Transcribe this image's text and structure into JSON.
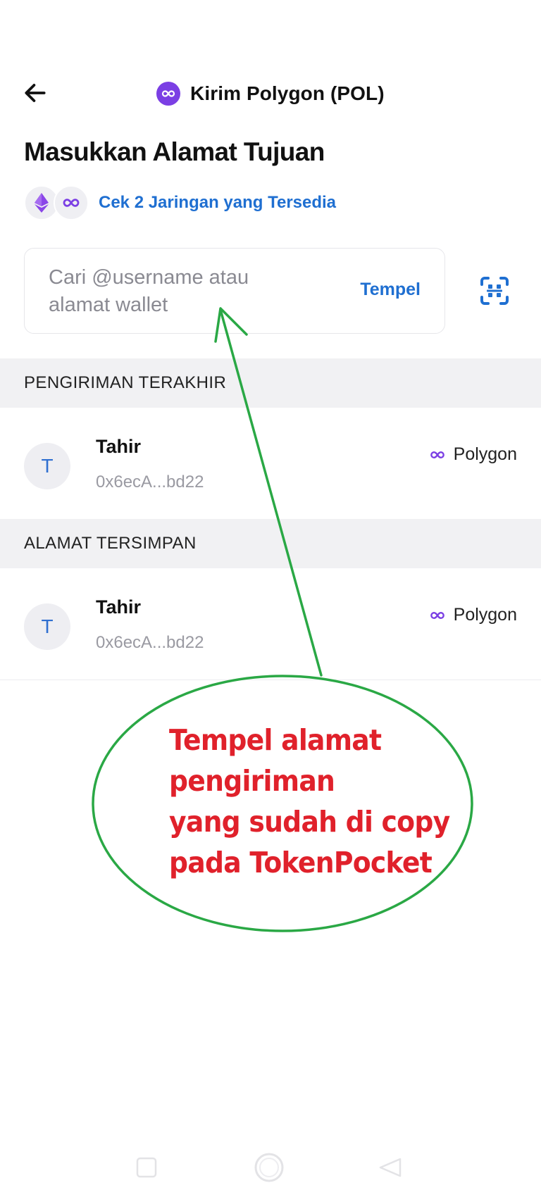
{
  "header": {
    "back_icon": "arrow-left-icon",
    "token_icon": "polygon-icon",
    "title": "Kirim Polygon (POL)"
  },
  "page_title": "Masukkan Alamat Tujuan",
  "networks": {
    "icons": [
      "ethereum-icon",
      "polygon-icon"
    ],
    "label": "Cek 2 Jaringan yang Tersedia"
  },
  "search": {
    "placeholder": "Cari @username atau alamat wallet",
    "paste_label": "Tempel",
    "scan_icon": "qr-scan-icon"
  },
  "recent": {
    "header": "PENGIRIMAN TERAKHIR",
    "items": [
      {
        "avatar": "T",
        "name": "Tahir",
        "address": "0x6ecA...bd22",
        "network": "Polygon"
      }
    ]
  },
  "saved": {
    "header": "ALAMAT TERSIMPAN",
    "items": [
      {
        "avatar": "T",
        "name": "Tahir",
        "address": "0x6ecA...bd22",
        "network": "Polygon"
      }
    ]
  },
  "annotation": {
    "lines": [
      "Tempel alamat",
      "pengiriman",
      "yang sudah di copy",
      "pada TokenPocket"
    ],
    "color": "#e0212b",
    "outline_color": "#2aa845"
  },
  "colors": {
    "accent": "#1f6fd1",
    "polygon": "#7b3fe4",
    "section_bg": "#f1f1f3"
  },
  "system_nav": [
    "recent-apps-icon",
    "home-icon",
    "back-icon"
  ]
}
